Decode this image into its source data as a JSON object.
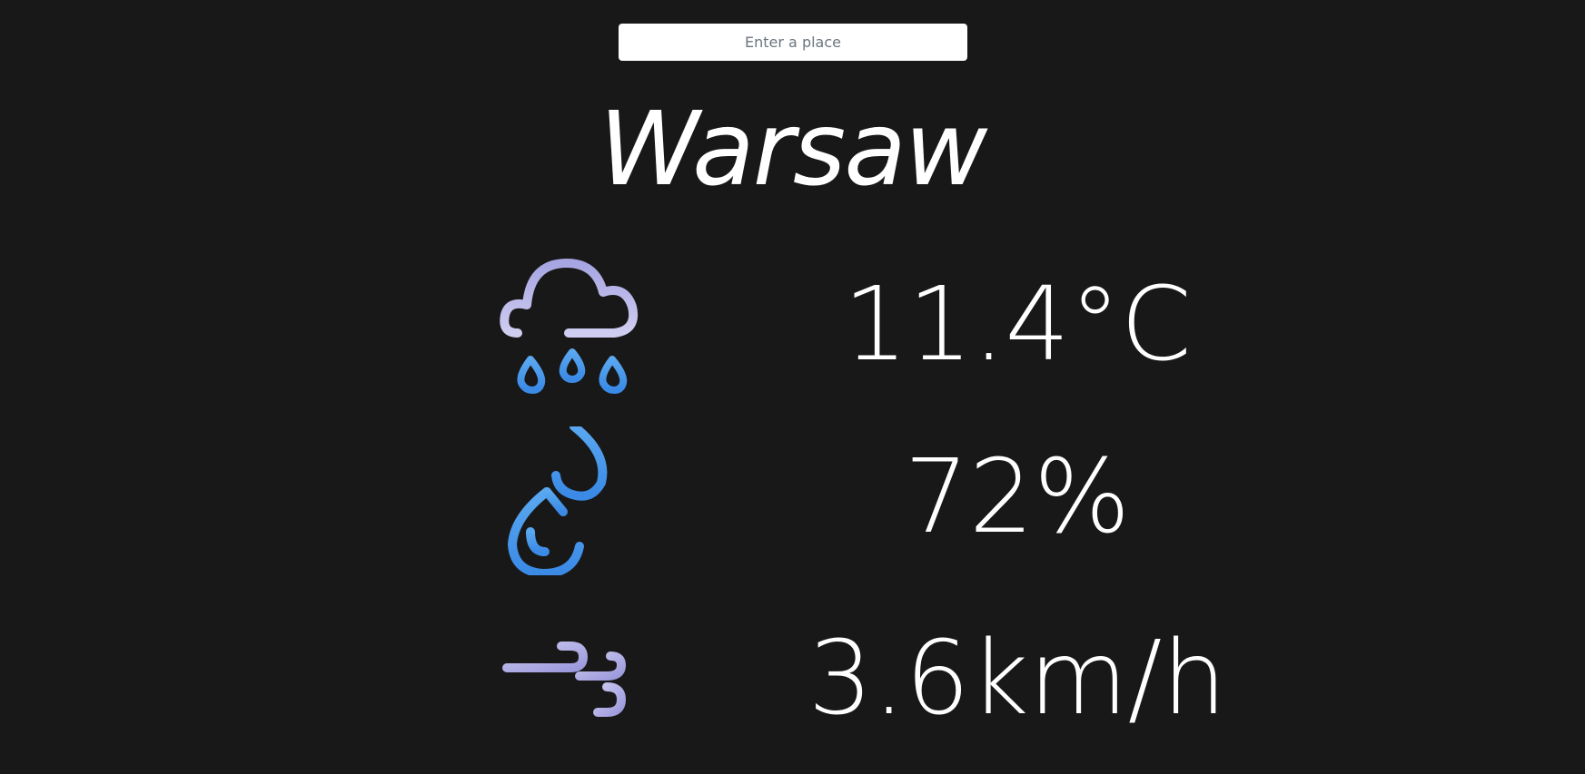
{
  "search": {
    "placeholder": "Enter a place",
    "value": ""
  },
  "location": {
    "city": "Warsaw"
  },
  "weather": {
    "temperature": "11.4°C",
    "humidity": "72%",
    "wind_speed": "3.6km/h",
    "condition_icon": "rain-cloud-icon",
    "humidity_icon": "humidity-drops-icon",
    "wind_icon": "wind-icon"
  },
  "colors": {
    "background": "#181818",
    "text": "#ffffff",
    "icon_lavender": "#b8b6e8",
    "icon_blue": "#3d8fe8"
  }
}
